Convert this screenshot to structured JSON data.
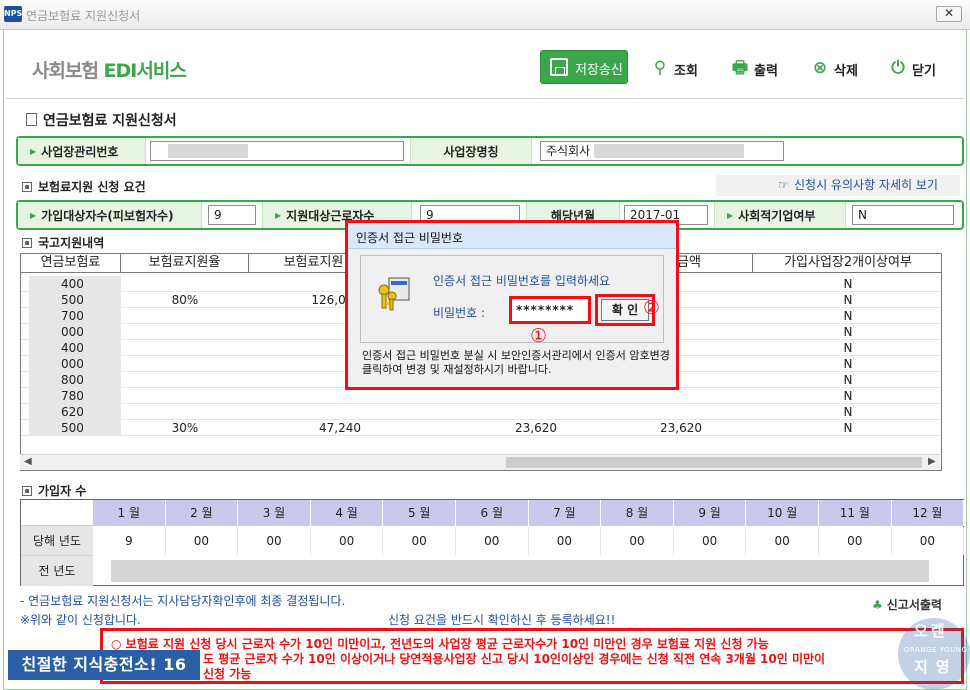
{
  "window": {
    "app_icon_text": "NPS",
    "title": "연금보험료 지원신청서",
    "close_glyph": "✕"
  },
  "header": {
    "brand_gray": "사회보험",
    "brand_green": "EDI서비스",
    "buttons": {
      "save": "저장송신",
      "search": "조회",
      "print": "출력",
      "delete": "삭제",
      "close": "닫기"
    }
  },
  "form_title": "연금보험료 지원신청서",
  "business": {
    "mgmt_no_label": "사업장관리번호",
    "name_label": "사업장명칭",
    "name_value": "주식회사"
  },
  "requirements": {
    "section_title": "보험료지원 신청 요건",
    "notice_link": "신청시 유의사항 자세히 보기",
    "subscribers_label": "가입대상자수(피보험자수)",
    "subscribers_value": "9",
    "supported_label": "지원대상근로자수",
    "supported_value": "9",
    "period_label": "해당년월",
    "period_value": "2017-01",
    "social_label": "사회적기업여부",
    "social_value": "N"
  },
  "support": {
    "section_title": "국고지원내역",
    "headers": [
      "연금보험료",
      "보험료지원율",
      "보험료지원",
      "",
      "",
      "금액",
      "가입사업장2개이상여부"
    ],
    "rows": [
      [
        "400",
        "",
        "",
        "",
        "",
        "",
        "N"
      ],
      [
        "500",
        "80%",
        "126,000",
        "",
        "",
        "",
        "N"
      ],
      [
        "700",
        "",
        "",
        "",
        "",
        "",
        "N"
      ],
      [
        "000",
        "",
        "",
        "",
        "",
        "",
        "N"
      ],
      [
        "400",
        "",
        "",
        "",
        "",
        "",
        "N"
      ],
      [
        "000",
        "",
        "",
        "",
        "",
        "",
        "N"
      ],
      [
        "800",
        "",
        "",
        "",
        "",
        "",
        "N"
      ],
      [
        "780",
        "",
        "",
        "",
        "",
        "",
        "N"
      ],
      [
        "620",
        "",
        "",
        "",
        "",
        "",
        "N"
      ],
      [
        "500",
        "30%",
        "47,240",
        "23,620",
        "",
        "23,620",
        "N"
      ]
    ]
  },
  "dialog": {
    "title": "인증서 접근 비밀번호",
    "prompt": "인증서 접근 비밀번호를 입력하세요",
    "password_label": "비밀번호 :",
    "password_value": "********",
    "ok_label": "확 인",
    "marker1": "①",
    "marker2": "②",
    "message": "인증서 접근 비밀번호 분실 시 보안인증서관리에서 인증서 암호변경 클릭하여 변경 및 재설정하시기 바랍니다."
  },
  "subscribers": {
    "section_title": "가입자 수",
    "months": [
      "1 월",
      "2 월",
      "3 월",
      "4 월",
      "5 월",
      "6 월",
      "7 월",
      "8 월",
      "9 월",
      "10 월",
      "11 월",
      "12 월"
    ],
    "current_label": "당해 년도",
    "current_values": [
      "9",
      "00",
      "00",
      "00",
      "00",
      "00",
      "00",
      "00",
      "00",
      "00",
      "00",
      "00"
    ],
    "previous_label": "전 년도"
  },
  "footer": {
    "note1": "- 연금보험료 지원신청서는 지사담당자확인후에 최종 결정됩니다.",
    "note2": "※위와 같이 신청합니다.",
    "note3": "신청 요건을 반드시 확인하신 후 등록하세요!!",
    "report_button": "신고서출력",
    "warn1": "○ 보험료 지원 신청 당시 근로자 수가 10인 미만이고, 전년도의 사업장 평균 근로자수가 10인 미만인 경우 보험료 지원 신청 가능",
    "warn2": "도 평균 근로자 수가 10인 이상이거나 당연적용사업장 신고 당시 10인이상인 경우에는 신청 직전 연속 3개월 10인 미만이",
    "warn3": "신청 가능",
    "banner": "친절한 지식충전소! 16",
    "watermark_top": "오렌",
    "watermark_mid": "ORANGE  YOUNG",
    "watermark_bot": "지영"
  },
  "colors": {
    "accent_green": "#3aa84a",
    "highlight_red": "#ee1111",
    "link_blue": "#1f4fa3",
    "month_header": "#c9c9ee"
  }
}
